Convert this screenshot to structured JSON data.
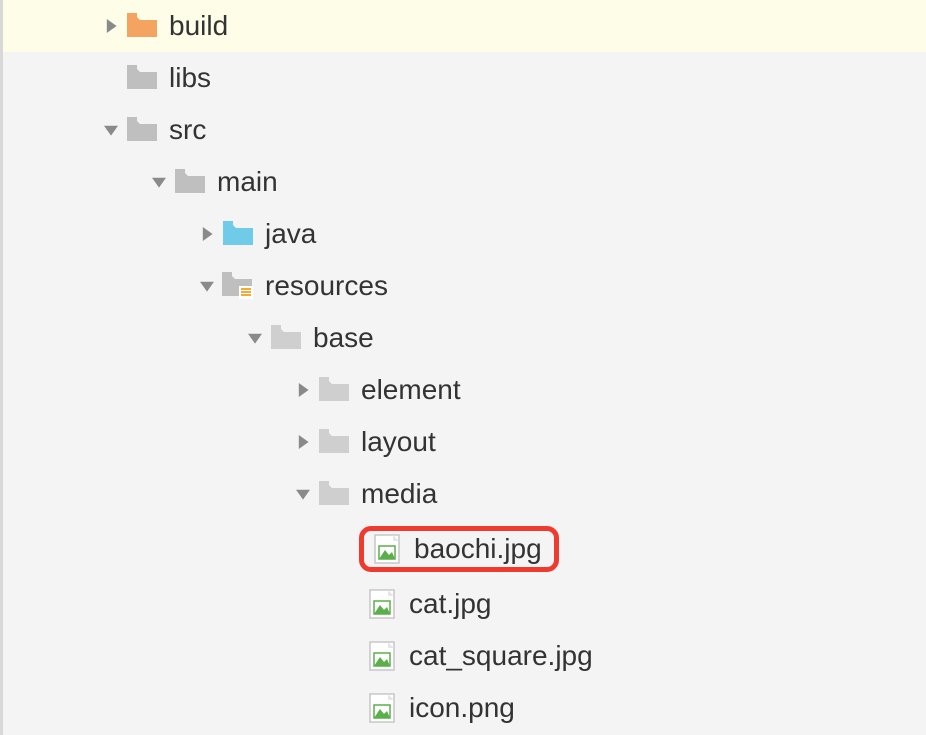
{
  "tree": {
    "build": "build",
    "libs": "libs",
    "src": "src",
    "main": "main",
    "java": "java",
    "resources": "resources",
    "base": "base",
    "element": "element",
    "layout": "layout",
    "media": "media",
    "baochi": "baochi.jpg",
    "cat": "cat.jpg",
    "cat_square": "cat_square.jpg",
    "icon_png": "icon.png"
  },
  "colors": {
    "folder_orange": "#f4a460",
    "folder_gray": "#bfbfbf",
    "folder_cyan": "#6fcbe8",
    "folder_light": "#cfcfcf",
    "highlight": "#ef3b2f"
  }
}
